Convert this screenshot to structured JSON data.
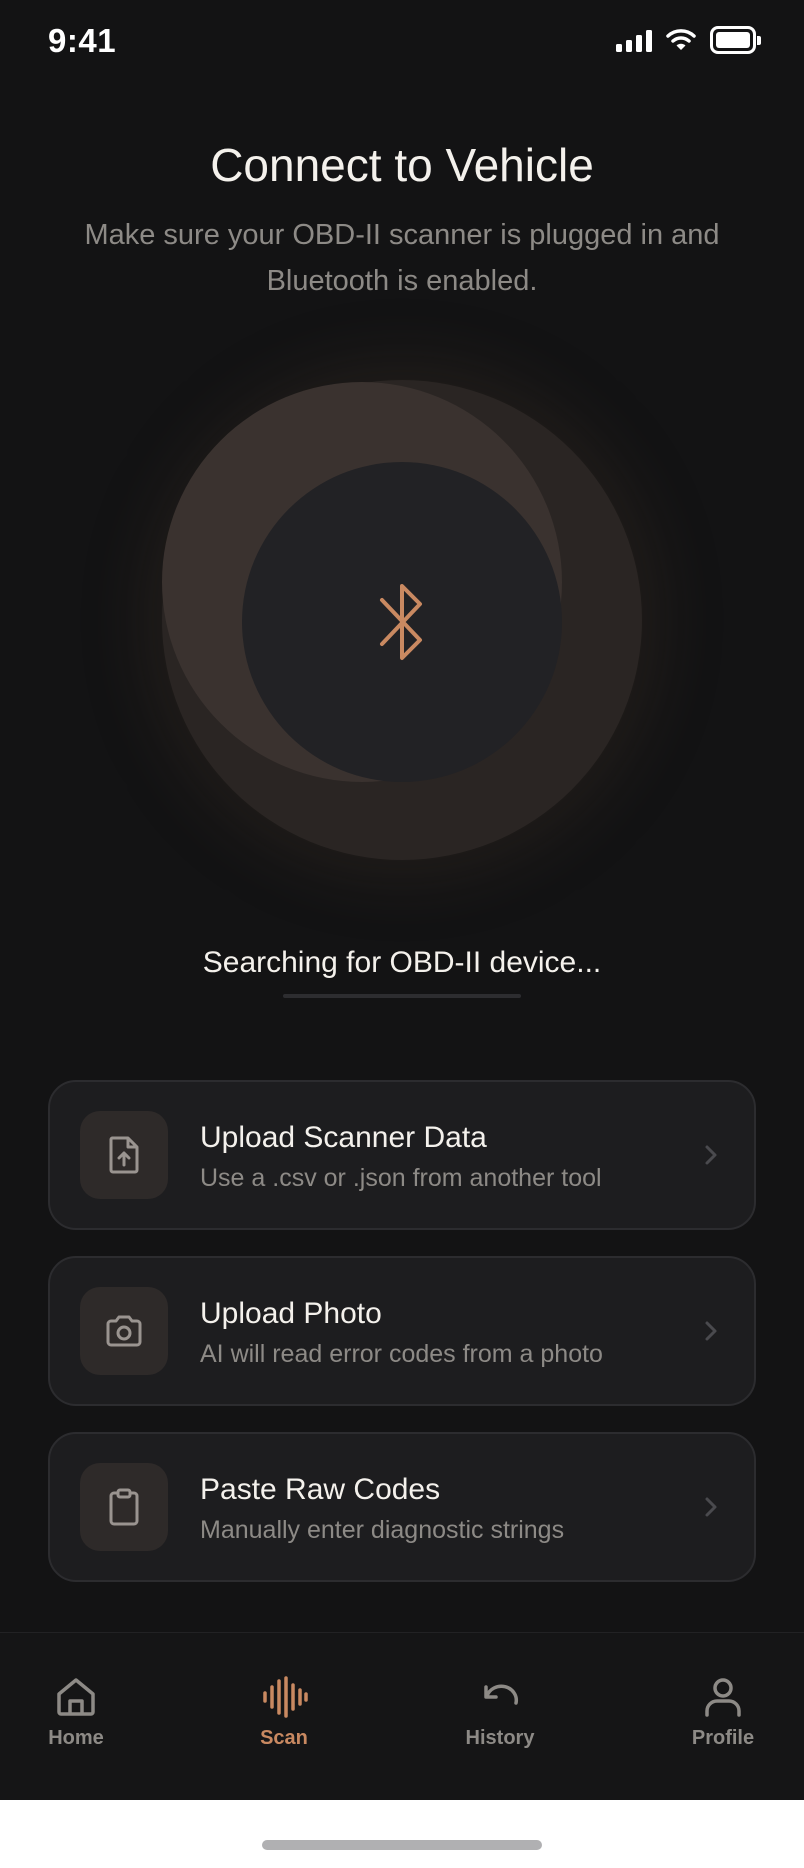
{
  "status_bar": {
    "time": "9:41"
  },
  "header": {
    "title": "Connect to Vehicle",
    "subtitle": "Make sure your OBD-II scanner is plugged in and Bluetooth is enabled."
  },
  "scanner": {
    "icon": "bluetooth-icon",
    "status_text": "Searching for OBD-II device...",
    "progress_fraction": 0.0
  },
  "options": [
    {
      "title": "Upload Scanner Data",
      "subtitle": "Use a .csv or .json from another tool",
      "icon": "file-upload-icon"
    },
    {
      "title": "Upload Photo",
      "subtitle": "AI will read error codes from a photo",
      "icon": "camera-icon"
    },
    {
      "title": "Paste Raw Codes",
      "subtitle": "Manually enter diagnostic strings",
      "icon": "clipboard-icon"
    }
  ],
  "tab_bar": {
    "tabs": [
      {
        "label": "Home",
        "icon": "home-icon",
        "active": false
      },
      {
        "label": "Scan",
        "icon": "waveform-icon",
        "active": true
      },
      {
        "label": "History",
        "icon": "undo-icon",
        "active": false
      },
      {
        "label": "Profile",
        "icon": "person-icon",
        "active": false
      }
    ]
  },
  "colors": {
    "accent": "#c98961",
    "background": "#131314",
    "card": "#1d1d1f",
    "muted_text": "#8d8a86"
  }
}
